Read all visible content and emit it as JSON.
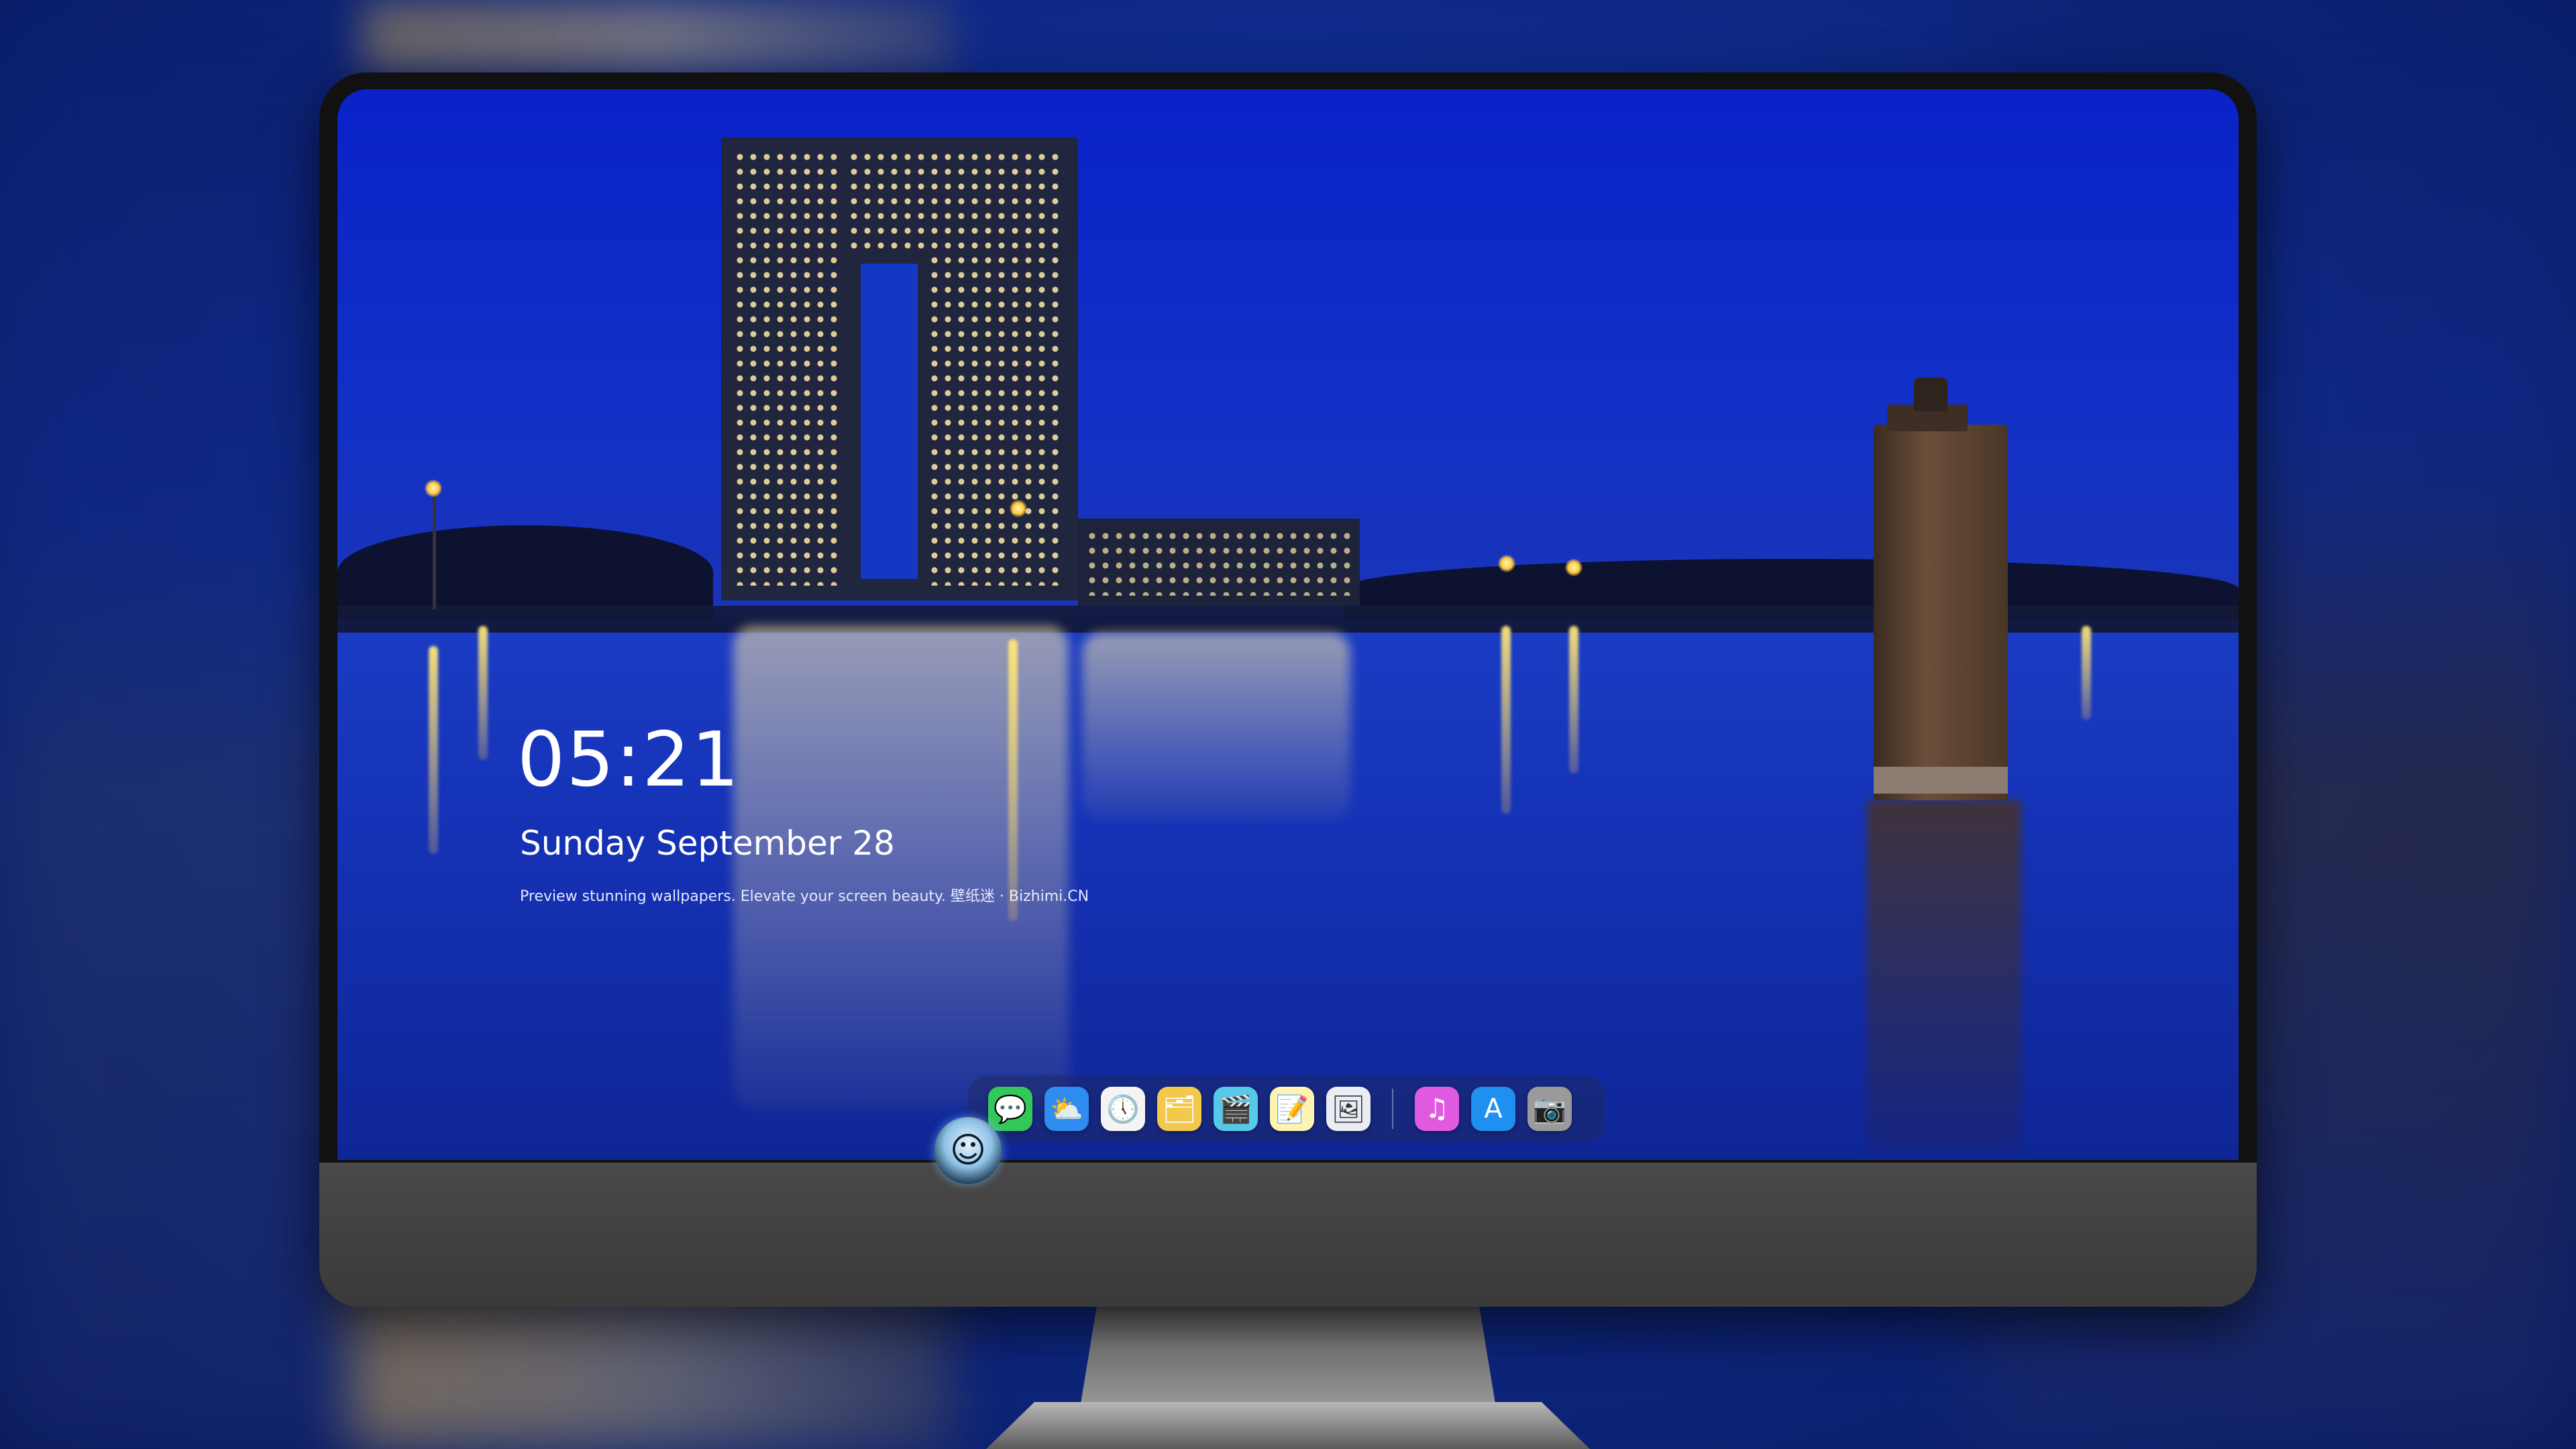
{
  "lock_screen": {
    "time": "05:21",
    "date": "Sunday September 28",
    "caption": "Preview stunning wallpapers. Elevate your screen beauty. 壁纸迷 · Bizhimi.CN"
  },
  "dock": {
    "items": [
      {
        "name": "Messages",
        "icon": "messages-icon",
        "color": "#35c759",
        "glyph": "💬"
      },
      {
        "name": "Weather",
        "icon": "weather-icon",
        "color": "#2f8cf0",
        "glyph": "⛅"
      },
      {
        "name": "Clock",
        "icon": "clock-icon",
        "color": "#f4f4f4",
        "glyph": "🕔"
      },
      {
        "name": "Preview",
        "icon": "preview-icon",
        "color": "#f2c94c",
        "glyph": "🗂"
      },
      {
        "name": "Clips",
        "icon": "clapperboard-icon",
        "color": "#56c8e8",
        "glyph": "🎬"
      },
      {
        "name": "Notes",
        "icon": "notes-icon",
        "color": "#fff3b0",
        "glyph": "📝"
      },
      {
        "name": "Photos",
        "icon": "photos-icon",
        "color": "#e9eef5",
        "glyph": "🖼"
      },
      {
        "name": "iTunes",
        "icon": "music-icon",
        "color": "#e05ae0",
        "glyph": "♫"
      },
      {
        "name": "App Store",
        "icon": "app-store-icon",
        "color": "#1f8ff0",
        "glyph": "A"
      },
      {
        "name": "Camera",
        "icon": "camera-icon",
        "color": "#9a9a9a",
        "glyph": "📷"
      }
    ]
  },
  "chin_logo": {
    "icon": "mascot-logo-icon"
  }
}
